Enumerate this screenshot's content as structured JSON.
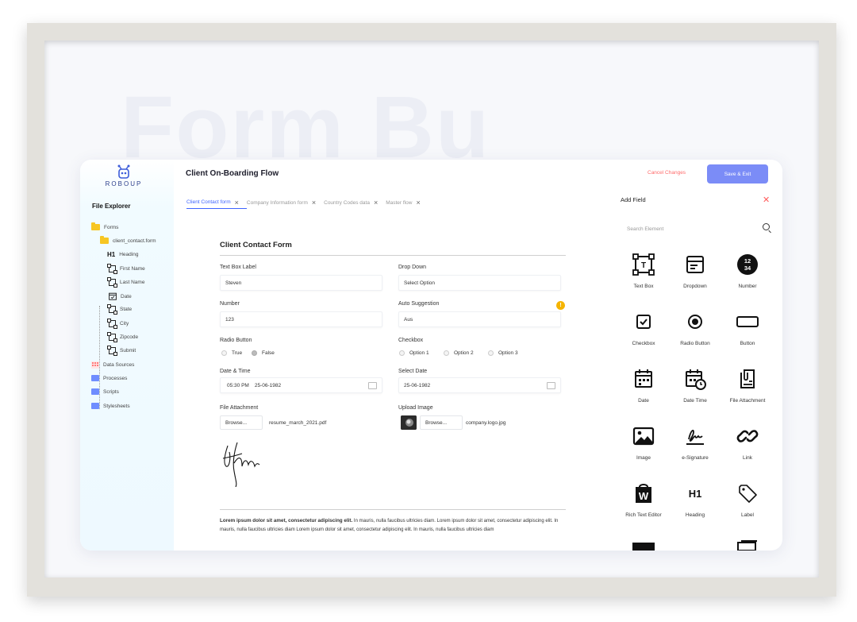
{
  "background_title": "Form Bu",
  "logo": {
    "text": "ROBOUP"
  },
  "header": {
    "title": "Client On-Boarding Flow",
    "cancel_label": "Cancel Changes",
    "save_label": "Save & Exit"
  },
  "sidebar": {
    "title": "File Explorer",
    "items": [
      {
        "label": "Forms",
        "icon": "folder-icon"
      },
      {
        "label": "client_contact.form",
        "icon": "file-icon"
      },
      {
        "label": "Heading",
        "icon": "h1-icon"
      },
      {
        "label": "First Name",
        "icon": "textbox-icon"
      },
      {
        "label": "Last Name",
        "icon": "textbox-icon"
      },
      {
        "label": "Date",
        "icon": "calendar-icon"
      },
      {
        "label": "State",
        "icon": "textbox-icon"
      },
      {
        "label": "City",
        "icon": "textbox-icon"
      },
      {
        "label": "Zipcode",
        "icon": "textbox-icon"
      },
      {
        "label": "Submit",
        "icon": "textbox-icon"
      },
      {
        "label": "Data Sources",
        "icon": "data-icon"
      },
      {
        "label": "Processes",
        "icon": "folder-icon"
      },
      {
        "label": "Scripts",
        "icon": "folder-icon"
      },
      {
        "label": "Stylesheets",
        "icon": "folder-icon"
      }
    ]
  },
  "tabs": [
    "Client Contact form",
    "Company Information form",
    "Country Codes data",
    "Master flow"
  ],
  "form": {
    "title": "Client Contact Form",
    "textbox": {
      "label": "Text Box Label",
      "value": "Steven"
    },
    "dropdown": {
      "label": "Drop Down",
      "value": "Select Option"
    },
    "number": {
      "label": "Number",
      "value": "123"
    },
    "autosuggest": {
      "label": "Auto Suggestion",
      "value": "Aus"
    },
    "radio": {
      "label": "Radio Button",
      "options": [
        "True",
        "False"
      ]
    },
    "checkbox": {
      "label": "Checkbox",
      "options": [
        "Option 1",
        "Option 2",
        "Option 3"
      ]
    },
    "datetime": {
      "label": "Date & Time",
      "time": "05:30 PM",
      "date": "25-06-1982"
    },
    "selectdate": {
      "label": "Select Date",
      "value": "25-06-1982"
    },
    "file": {
      "label": "File Attachment",
      "browse": "Browse...",
      "filename": "resume_march_2021.pdf"
    },
    "image": {
      "label": "Upload Image",
      "browse": "Browse...",
      "filename": "company.logo.jpg"
    },
    "paragraph_bold": "Lorem ipsum dolor sit amet, consectetur adipiscing elit.",
    "paragraph_text": " In mauris, nulla faucibus ultricies diam. Lorem ipsum dolor sit amet, consectetur adipiscing elit. In mauris, nulla faucibus ultricies diam Lorem ipsum dolor sit amet, consectetur adipiscing elit. In mauris, nulla faucibus ultricies diam"
  },
  "panel": {
    "title": "Add Field",
    "search_placeholder": "Search Element",
    "fields": [
      "Text Box",
      "Dropdown",
      "Number",
      "Checkbox",
      "Radio Button",
      "Button",
      "Date",
      "Date Time",
      "File Attachment",
      "Image",
      "e-Signature",
      "Link",
      "Rich Text Editor",
      "Heading",
      "Label"
    ]
  },
  "colors": {
    "accent": "#3e64ff",
    "save_button": "#7b8cf7",
    "cancel": "#ff6b6b",
    "folder_yellow": "#f7c623",
    "folder_blue": "#6f8dff",
    "info": "#f5b400"
  }
}
